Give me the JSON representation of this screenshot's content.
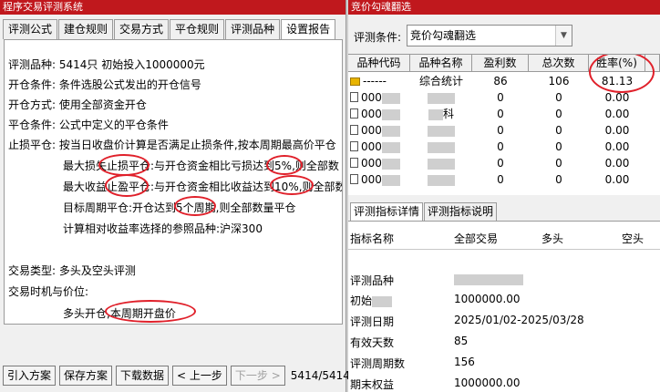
{
  "left": {
    "title": "程序交易评测系统",
    "tabs": [
      "评测公式",
      "建仓规则",
      "交易方式",
      "平仓规则",
      "评测品种",
      "设置报告"
    ],
    "report": {
      "l1_label": "评测品种:",
      "l1_value": "5414只 初始投入1000000元",
      "l2_label": "开仓条件:",
      "l2_value": "条件选股公式发出的开仓信号",
      "l3_label": "开仓方式:",
      "l3_value": "使用全部资金开仓",
      "l4_label": "平仓条件:",
      "l4_value": "公式中定义的平仓条件",
      "l5_label": "止损平仓:",
      "l5_value": "按当日收盘价计算是否满足止损条件,按本周期最高价平仓",
      "l6": "最大损失止损平仓:与开仓资金相比亏损达到5%,则全部数",
      "l7": "最大收益止盈平仓:与开仓资金相比收益达到10%,则全部数",
      "l8": "目标周期平仓:开仓达到5个周期,则全部数量平仓",
      "l9": "计算相对收益率选择的参照品种:沪深300",
      "l10_label": "交易类型:",
      "l10_value": "多头及空头评测",
      "l11": "交易时机与价位:",
      "l12": "多头开仓,本周期开盘价"
    },
    "buttons": {
      "import": "引入方案",
      "save": "保存方案",
      "download": "下载数据",
      "prev": "< 上一步",
      "next": "下一步 >"
    },
    "pager": "5414/5414"
  },
  "right": {
    "title": "竞价勾魂翻选",
    "condition_label": "评测条件:",
    "condition_value": "竞价勾魂翻选",
    "grid": {
      "columns": [
        "品种代码",
        "品种名称",
        "盈利数",
        "总次数",
        "胜率(%)"
      ],
      "summary": {
        "code": "------",
        "name": "综合统计",
        "wins": "86",
        "total": "106",
        "rate": "81.13"
      },
      "rows": [
        {
          "code": "000",
          "name": "",
          "wins": "0",
          "total": "0",
          "rate": "0.00"
        },
        {
          "code": "000",
          "name": "科",
          "wins": "0",
          "total": "0",
          "rate": "0.00"
        },
        {
          "code": "000",
          "name": "",
          "wins": "0",
          "total": "0",
          "rate": "0.00"
        },
        {
          "code": "000",
          "name": "",
          "wins": "0",
          "total": "0",
          "rate": "0.00"
        },
        {
          "code": "000",
          "name": "",
          "wins": "0",
          "total": "0",
          "rate": "0.00"
        },
        {
          "code": "000",
          "name": "",
          "wins": "0",
          "total": "0",
          "rate": "0.00"
        }
      ]
    },
    "tabs": [
      "评测指标详情",
      "评测指标说明"
    ],
    "detail": {
      "headers": [
        "指标名称",
        "全部交易",
        "多头",
        "空头"
      ],
      "rows": [
        {
          "label": "评测品种",
          "value": ""
        },
        {
          "label": "初始",
          "value": "1000000.00"
        },
        {
          "label": "评测日期",
          "value": "2025/01/02-2025/03/28"
        },
        {
          "label": "有效天数",
          "value": "85"
        },
        {
          "label": "评测周期数",
          "value": "156"
        },
        {
          "label": "期末权益",
          "value": "1000000.00"
        }
      ]
    }
  }
}
